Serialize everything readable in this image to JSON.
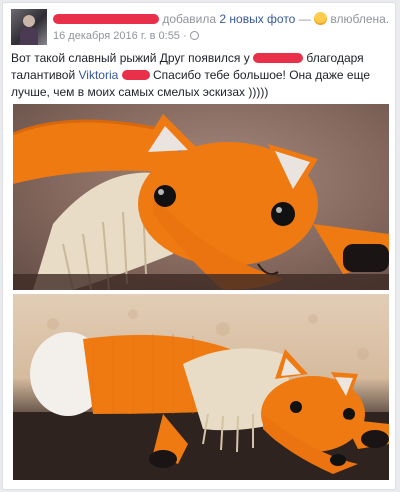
{
  "post": {
    "action_text": "добавила",
    "photos_link": "2 новых фото",
    "dash": "—",
    "feeling": "влюблена.",
    "date": "16 декабря 2016 г. в 0:55",
    "privacy_separator": "·",
    "text": {
      "part1": "Вот такой славный рыжий Друг появился у ",
      "part2": " благодаря талантивой ",
      "mention": "Viktoria",
      "part3": " Спасибо тебе большое! Она даже еще лучше, чем в моих самых смелых эскизах )))))"
    }
  },
  "icons": {
    "feeling": "smiling-in-love-emoji-icon",
    "privacy": "globe-icon"
  },
  "colors": {
    "link": "#365899",
    "redaction": "#e8304a",
    "fox_orange": "#f07a12"
  }
}
